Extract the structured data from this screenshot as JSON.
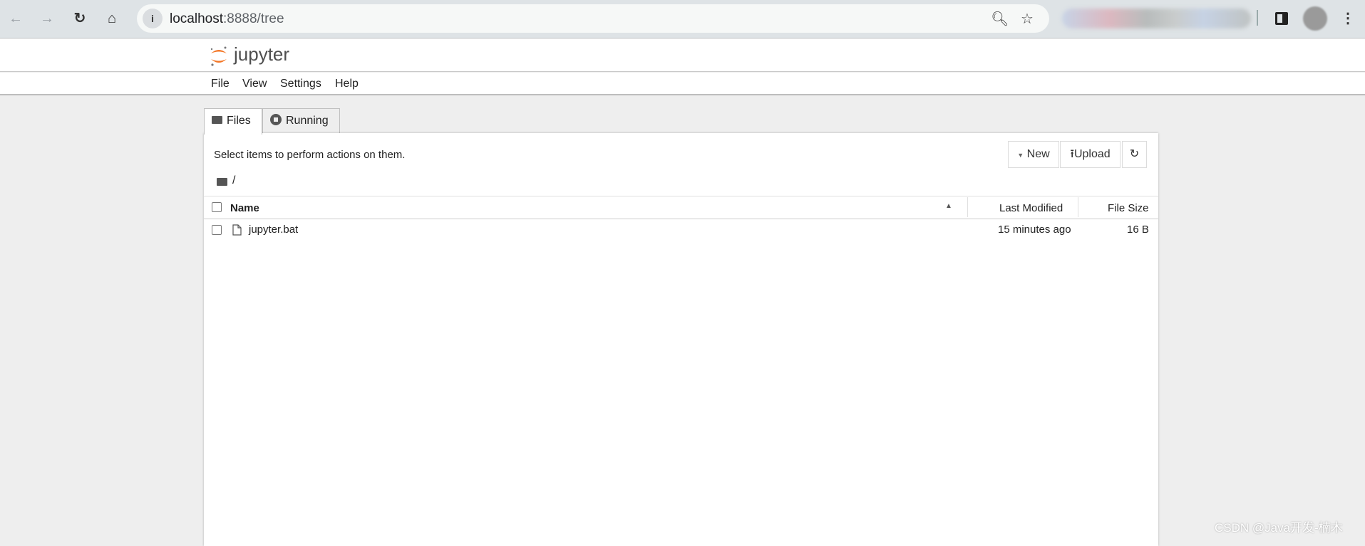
{
  "browser": {
    "url_host": "localhost",
    "url_rest": ":8888/tree",
    "icons": [
      "back-icon",
      "forward-icon",
      "reload-icon",
      "home-icon",
      "info-icon",
      "zoom-icon",
      "star-icon",
      "sidebar-icon",
      "menu-icon"
    ]
  },
  "header": {
    "logo_text": "jupyter",
    "brand_color": "#f37626"
  },
  "menu": [
    "File",
    "View",
    "Settings",
    "Help"
  ],
  "tabs": [
    {
      "label": "Files",
      "active": true
    },
    {
      "label": "Running",
      "active": false
    }
  ],
  "toolbar": {
    "hint": "Select items to perform actions on them.",
    "new_label": "New",
    "upload_label": "Upload"
  },
  "breadcrumb": "/",
  "table": {
    "columns": [
      "Name",
      "Last Modified",
      "File Size"
    ],
    "sort": "Name ascending",
    "rows": [
      {
        "name": "jupyter.bat",
        "modified": "15 minutes ago",
        "size": "16 B"
      }
    ]
  },
  "watermark": "CSDN @Java开发-楠木"
}
